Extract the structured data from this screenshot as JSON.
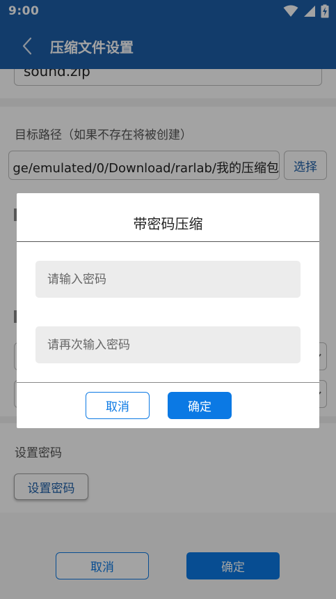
{
  "status_bar": {
    "time": "9:00"
  },
  "app_bar": {
    "title": "压缩文件设置"
  },
  "archive_name": {
    "value": "sound.zip"
  },
  "destination": {
    "label": "目标路径（如果不存在将被创建）",
    "path_value": "ge/emulated/0/Download/rarlab/我的压缩包",
    "browse_label": "选择"
  },
  "password_section": {
    "label": "设置密码",
    "button_label": "设置密码"
  },
  "footer": {
    "cancel_label": "取消",
    "ok_label": "确定"
  },
  "dialog": {
    "title": "带密码压缩",
    "password_placeholder": "请输入密码",
    "confirm_placeholder": "请再次输入密码",
    "cancel_label": "取消",
    "ok_label": "确定"
  },
  "colors": {
    "primary": "#1d5fa8",
    "accent": "#0b79e4"
  }
}
